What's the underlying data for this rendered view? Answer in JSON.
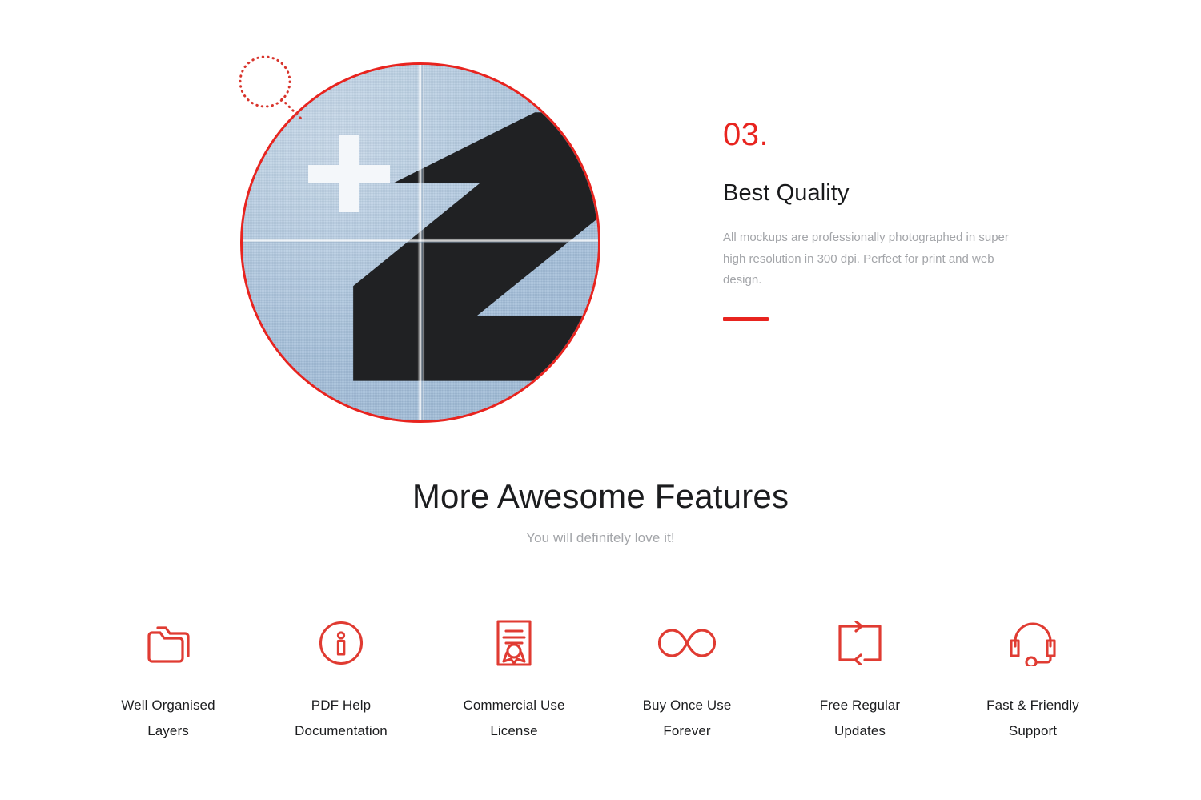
{
  "theme": {
    "accent_red": "#e8241f",
    "text_dark": "#1c1d1f",
    "text_muted": "#a3a5a9",
    "paper_blue": "#a9c3dc",
    "background": "#ffffff"
  },
  "hero": {
    "number": "03.",
    "title": "Best Quality",
    "body": "All mockups are professionally photographed in super high resolution in 300 dpi. Perfect for print and web design.",
    "media": {
      "alt": "Blue textured folded paper poster with white plus sign and large black Z letterform, shown in a red circular frame",
      "annotation_icon": "dotted-lasso-marker"
    }
  },
  "features": {
    "heading": "More Awesome Features",
    "subheading": "You will definitely love it!",
    "items": [
      {
        "icon": "folders-icon",
        "label": "Well Organised Layers"
      },
      {
        "icon": "info-circle-icon",
        "label": "PDF Help Documentation"
      },
      {
        "icon": "certificate-icon",
        "label": "Commercial Use License"
      },
      {
        "icon": "infinity-icon",
        "label": "Buy Once Use Forever"
      },
      {
        "icon": "refresh-loop-icon",
        "label": "Free Regular Updates"
      },
      {
        "icon": "headset-icon",
        "label": "Fast & Friendly Support"
      }
    ]
  }
}
